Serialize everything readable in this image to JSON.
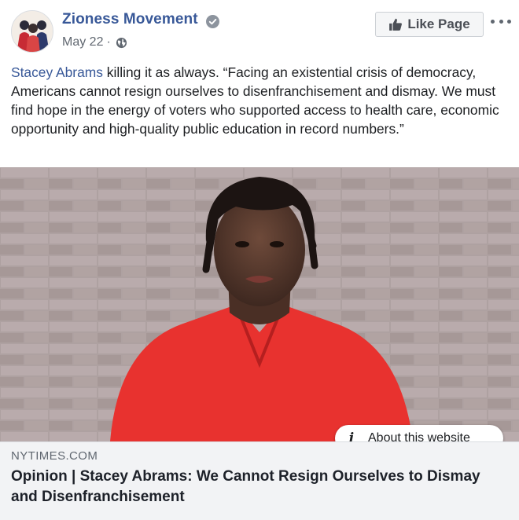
{
  "header": {
    "page_name": "Zioness Movement",
    "date": "May 22",
    "separator": "·",
    "like_label": "Like Page",
    "icons": {
      "verified": "verified-badge-icon",
      "privacy": "globe-icon",
      "like": "thumbs-up-icon",
      "more": "more-options-icon"
    }
  },
  "post": {
    "mention": "Stacey Abrams",
    "text": " killing it as always. “Facing an existential crisis of democracy, Americans cannot resign ourselves to disenfranchisement and dismay. We must find hope in the energy of voters who supported access to health care, economic opportunity and high-quality public education in record numbers.”"
  },
  "link": {
    "about_label": "About this website",
    "domain": "NYTIMES.COM",
    "headline": "Opinion | Stacey Abrams: We Cannot Resign Ourselves to Dismay and Disenfranchisement"
  },
  "colors": {
    "link_blue": "#385898",
    "meta_gray": "#606770",
    "footer_bg": "#f2f3f5",
    "shirt_red": "#e8322f"
  }
}
